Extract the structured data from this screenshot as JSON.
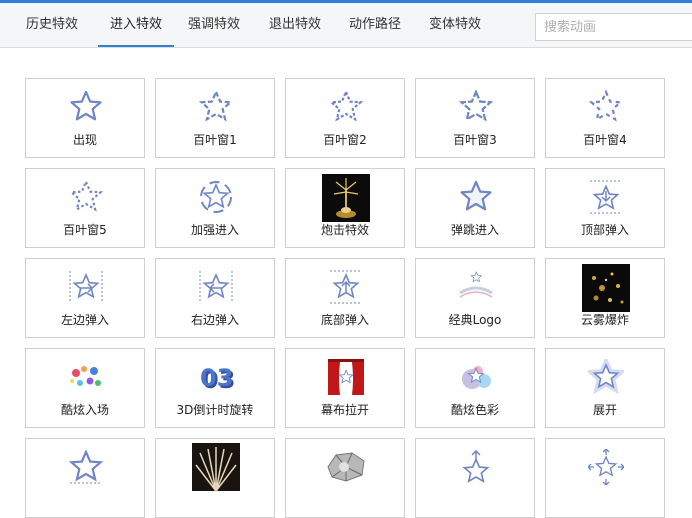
{
  "tabs": [
    {
      "label": "历史特效",
      "active": false
    },
    {
      "label": "进入特效",
      "active": true
    },
    {
      "label": "强调特效",
      "active": false
    },
    {
      "label": "退出特效",
      "active": false
    },
    {
      "label": "动作路径",
      "active": false
    },
    {
      "label": "变体特效",
      "active": false
    }
  ],
  "search": {
    "placeholder": "搜索动画"
  },
  "colors": {
    "accent": "#2f7ed8",
    "star": "#6f86c6"
  },
  "effects": [
    {
      "label": "出现",
      "icon": "star-solid-icon"
    },
    {
      "label": "百叶窗1",
      "icon": "star-blinds-icon"
    },
    {
      "label": "百叶窗2",
      "icon": "star-blinds-icon"
    },
    {
      "label": "百叶窗3",
      "icon": "star-blinds-icon"
    },
    {
      "label": "百叶窗4",
      "icon": "star-blinds-icon"
    },
    {
      "label": "百叶窗5",
      "icon": "star-blinds-icon"
    },
    {
      "label": "加强进入",
      "icon": "star-spin-icon"
    },
    {
      "label": "炮击特效",
      "icon": "fireworks-thumbnail"
    },
    {
      "label": "弹跳进入",
      "icon": "star-solid-icon"
    },
    {
      "label": "顶部弹入",
      "icon": "star-arrow-down-icon"
    },
    {
      "label": "左边弹入",
      "icon": "star-arrow-right-icon"
    },
    {
      "label": "右边弹入",
      "icon": "star-arrow-left-icon"
    },
    {
      "label": "底部弹入",
      "icon": "star-arrow-up-icon"
    },
    {
      "label": "经典Logo",
      "icon": "logo-icon"
    },
    {
      "label": "云雾爆炸",
      "icon": "sparkle-thumbnail"
    },
    {
      "label": "酷炫入场",
      "icon": "color-dots-icon"
    },
    {
      "label": "3D倒计时旋转",
      "icon": "countdown-3d-icon"
    },
    {
      "label": "幕布拉开",
      "icon": "curtain-icon"
    },
    {
      "label": "酷炫色彩",
      "icon": "color-bubbles-icon"
    },
    {
      "label": "展开",
      "icon": "star-glow-icon"
    },
    {
      "label": "",
      "icon": "star-zoom-icon"
    },
    {
      "label": "",
      "icon": "feather-burst-thumbnail"
    },
    {
      "label": "",
      "icon": "shatter-thumbnail"
    },
    {
      "label": "",
      "icon": "star-arrow-up-icon"
    },
    {
      "label": "",
      "icon": "star-expand-arrows-icon"
    }
  ]
}
